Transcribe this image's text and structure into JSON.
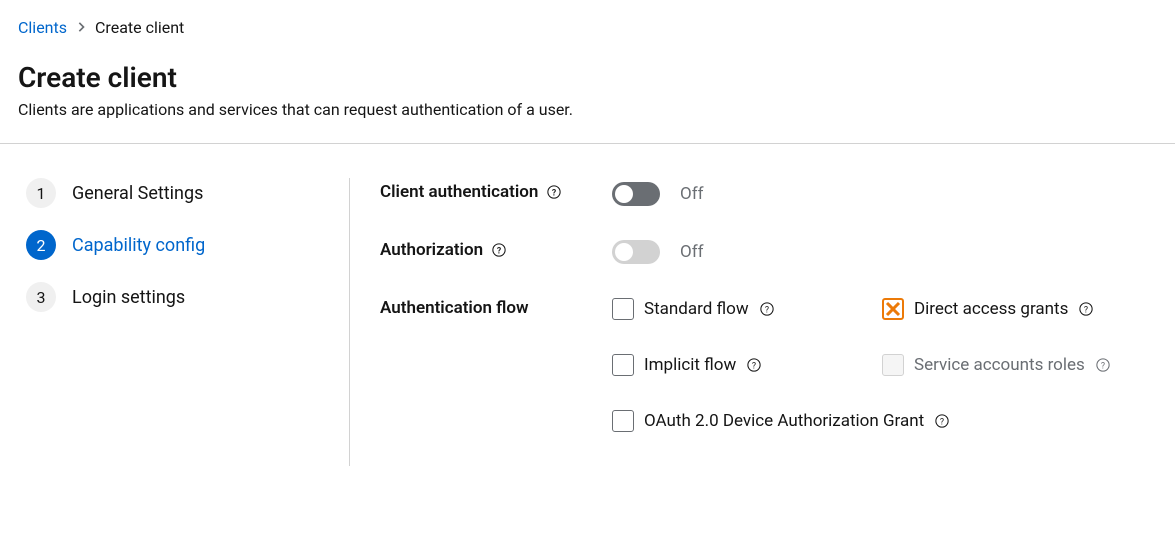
{
  "breadcrumb": {
    "parent": "Clients",
    "current": "Create client"
  },
  "header": {
    "title": "Create client",
    "subtitle": "Clients are applications and services that can request authentication of a user."
  },
  "wizard": {
    "steps": [
      {
        "num": "1",
        "label": "General Settings",
        "active": false
      },
      {
        "num": "2",
        "label": "Capability config",
        "active": true
      },
      {
        "num": "3",
        "label": "Login settings",
        "active": false
      }
    ]
  },
  "form": {
    "clientAuth": {
      "label": "Client authentication",
      "state": "Off",
      "enabled": true
    },
    "authorization": {
      "label": "Authorization",
      "state": "Off",
      "enabled": false
    },
    "authFlow": {
      "label": "Authentication flow",
      "flows": {
        "standard": {
          "label": "Standard flow",
          "checked": false,
          "disabled": false,
          "marked": false
        },
        "direct": {
          "label": "Direct access grants",
          "checked": false,
          "disabled": false,
          "marked": true
        },
        "implicit": {
          "label": "Implicit flow",
          "checked": false,
          "disabled": false,
          "marked": false
        },
        "service": {
          "label": "Service accounts roles",
          "checked": false,
          "disabled": true,
          "marked": false
        },
        "oauthDevice": {
          "label": "OAuth 2.0 Device Authorization Grant",
          "checked": false,
          "disabled": false,
          "marked": false
        }
      }
    }
  }
}
